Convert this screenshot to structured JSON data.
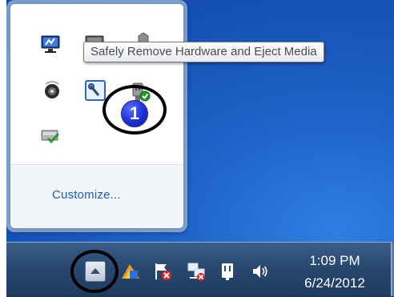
{
  "tooltip": {
    "text": "Safely Remove Hardware and Eject Media"
  },
  "overflow_panel": {
    "customize_label": "Customize...",
    "icons": [
      "network-monitor-icon",
      "display-icon",
      "partial-icon",
      "speaker-round-icon",
      "wrench-tool-icon",
      "safely-remove-hardware-icon",
      "check-device-icon"
    ]
  },
  "callout": {
    "number": "1"
  },
  "taskbar": {
    "show_hidden_icons": "chevron-up-icon",
    "icons": [
      "app-color-icon",
      "action-center-flag-icon",
      "network-icon",
      "power-plug-icon",
      "volume-icon"
    ],
    "clock": {
      "time": "1:09 PM",
      "date": "6/24/2012"
    }
  },
  "colors": {
    "desktop": "#1a5ac0",
    "taskbar": "#2a4a72",
    "link": "#1c5fb8",
    "callout_blue": "#1c2fd6"
  }
}
